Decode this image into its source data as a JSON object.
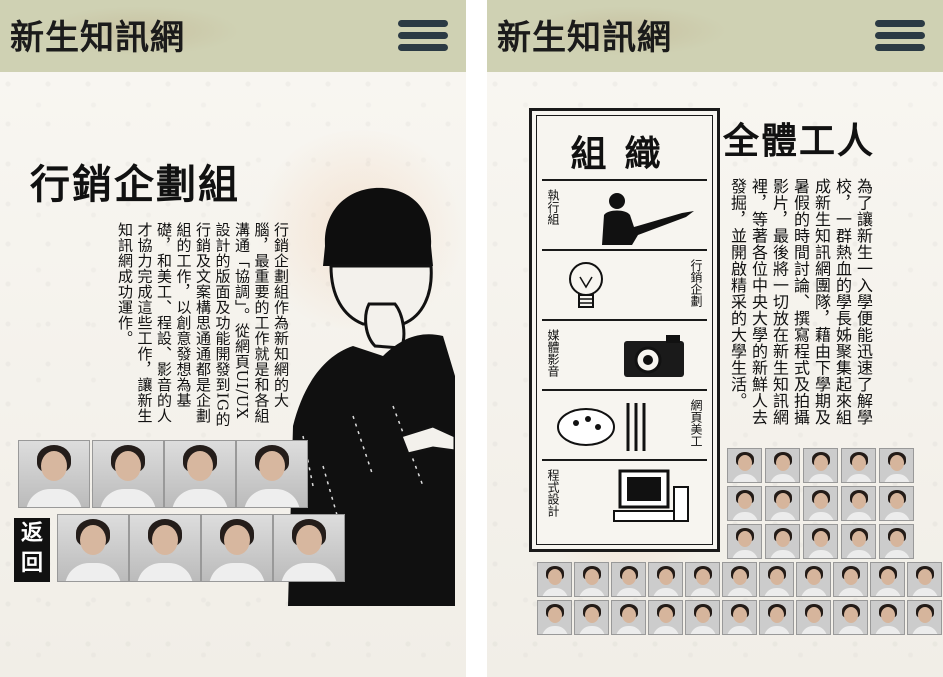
{
  "left": {
    "logo": "新生知訊網",
    "title": "行銷企劃組",
    "body": "行銷企劃組作為新知網的大腦，最重要的工作就是和各組溝通「協調」。從網頁UI/UX設計的版面及功能開發到IG的行銷及文案構思通通都是企劃組的工作，以創意發想為基礎，和美工、程設、影音的人才協力完成這些工作，讓新生知訊網成功運作。",
    "back_label": "返回"
  },
  "right": {
    "logo": "新生知訊網",
    "title": "全體工人",
    "body": "為了讓新生一入學便能迅速了解學校，一群熱血的學長姊聚集起來組成新生知訊網團隊，藉由下學期及暑假的時間討論、撰寫程式及拍攝影片，最後將一切放在新生知訊網裡，等著各位中央大學的新鮮人去發掘，並開啟精采的大學生活。",
    "org": {
      "title": "組織",
      "units": [
        "執行組",
        "行銷企劃",
        "媒體影音",
        "網頁美工",
        "程式設計"
      ]
    }
  },
  "colors": {
    "header_bg": "#cfd1b3",
    "menu_icon": "#2b3a44",
    "ink": "#111111",
    "paper": "#f6f4ef"
  },
  "icons": [
    "hamburger-menu-icon",
    "pointing-man-icon",
    "light-bulb-icon",
    "camera-icon",
    "palette-brushes-icon",
    "computer-icon"
  ]
}
